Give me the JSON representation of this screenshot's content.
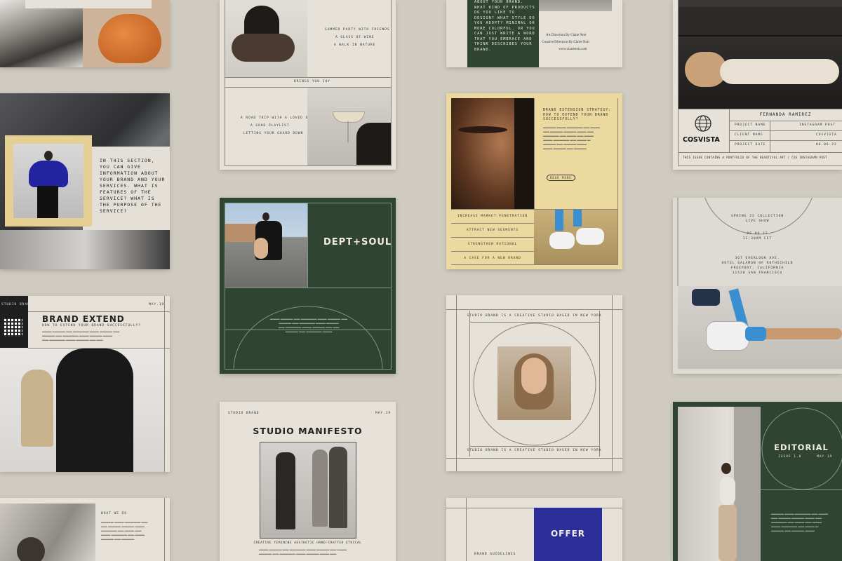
{
  "card_tl": {},
  "card_moody": {
    "paragraph": "IN THIS SECTION, YOU CAN GIVE INFORMATION ABOUT YOUR BRAND AND YOUR SERVICES. WHAT IS FEATURES OF THE SERVICE? WHAT IS THE PURPOSE OF THE SERVICE?"
  },
  "card_brand_extend": {
    "studio_label": "STUDIO BRAND",
    "title": "BRAND EXTEND",
    "subtitle": "HOW TO EXTEND YOUR BRAND SUCCESSFULLY?",
    "date": "MAY.19"
  },
  "card_what": {
    "label": "WHAT WE DO"
  },
  "card_summer": {
    "line1": "SUMMER PARTY WITH FRIENDS",
    "line2": "A GLASS OF WINE",
    "line3": "A WALK IN NATURE",
    "center": "BRINGS YOU JOY",
    "line4": "A ROAD TRIP WITH A LOVED ONE",
    "line5": "A GOOD PLAYLIST",
    "line6": "LETTING YOUR GUARD DOWN"
  },
  "card_dept": {
    "title": "DEPT+SOUL"
  },
  "card_manifesto": {
    "studio_label": "STUDIO BRAND",
    "date": "MAY.19",
    "title": "STUDIO MANIFESTO",
    "caption": "CREATIVE FEMININE AESTHETIC HAND-CRAFTED ETHICAL"
  },
  "card_style": {
    "question": "ABOUT YOUR BRAND. WHAT KIND OF PRODUCTS DO YOU LIKE TO DESIGN? WHAT STYLE DO YOU ADOPT? MINIMAL OR MORE COLORFUL. OR YOU CAN JUST WRITE A WORD THAT YOU EMBRACE AND THINK DESCRIBES YOUR BRAND.",
    "credit1": "Art Direction By Claire Noir",
    "credit2": "Creative Direction By Claire Noir",
    "url": "www.clairenoir.com"
  },
  "card_extension": {
    "heading": "BRAND EXTENSION STRATEGY: HOW TO EXTEND YOUR BRAND SUCCESSFULLY?",
    "button": "READ MORE",
    "items": [
      "INCREASE MARKET PENETRATION",
      "ATTRACT NEW SEGMENTS",
      "STRENGTHEN RATIONAL",
      "A CASE FOR A NEW BRAND"
    ]
  },
  "card_studio_ny": {
    "top": "STUDIO BRAND IS A CREATIVE STUDIO BASED IN NEW YORK",
    "bottom": "STUDIO BRAND IS A CREATIVE STUDIO BASED IN NEW YORK"
  },
  "card_offer": {
    "label": "BRAND GUIDELINES",
    "button": "OFFER"
  },
  "card_cosvista": {
    "name": "FERNANDA RAMIREZ",
    "logo": "COSVISTA",
    "rows": [
      {
        "label": "PROJECT NAME",
        "value": "INSTAGRAM POST"
      },
      {
        "label": "CLIENT NAME",
        "value": "COSVISTA"
      },
      {
        "label": "PROJECT DATE",
        "value": "06.06.22"
      }
    ],
    "footer": "THIS ISSUE CONTAINS A PORTFOLIO OF THE BEAUTIFUL ART / COS INSTAGRAM POST"
  },
  "card_spring": {
    "l1": "SPRING 22 COLLECTION",
    "l2": "LIVE SHOW",
    "l3": "06.06.22",
    "l4": "11:30AM CET",
    "l5": "367 OVERLOOK AVE.",
    "l6": "HOTEL SALAMON OF ROTHSCHILD",
    "l7": "FREEPORT, CALIFORNIA",
    "l8": "11520 SAN FRANCISCO"
  },
  "card_editorial": {
    "title": "EDITORIAL",
    "issue": "ISSUE 1.0",
    "date": "MAY 19"
  },
  "colors": {
    "background": "#cfcbc1",
    "cream": "#e6e2da",
    "forest_green": "#2f4433",
    "mustard": "#ecd9a0",
    "cobalt": "#2c2f9a"
  }
}
